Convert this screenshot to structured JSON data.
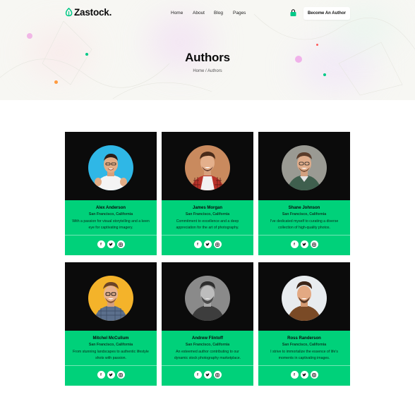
{
  "brand": {
    "name": "Zastock.",
    "color": "#00c987"
  },
  "nav": {
    "items": [
      {
        "label": "Home"
      },
      {
        "label": "About"
      },
      {
        "label": "Blog"
      },
      {
        "label": "Pages"
      }
    ],
    "cart_icon": "cart-icon",
    "cta_label": "Become An Author"
  },
  "hero": {
    "title": "Authors",
    "breadcrumb": "Home / Authors"
  },
  "authors": [
    {
      "name": "Alex Anderson",
      "location": "San Francisco, California",
      "bio": "With a passion for visual storytelling and a keen eye for captivating imagery.",
      "avatar_bg": "#2fb7e6"
    },
    {
      "name": "James Morgan",
      "location": "San Francisco, California",
      "bio": "Commitment to excellence and a deep appreciation for the art of photography.",
      "avatar_bg": "#c98a5e"
    },
    {
      "name": "Shane Johnson",
      "location": "San Francisco, California",
      "bio": "I've dedicated myself to curating a diverse collection of high-quality photos.",
      "avatar_bg": "#9a9a93"
    },
    {
      "name": "Mitchel McCullum",
      "location": "San Francisco, California",
      "bio": "From stunning landscapes to authentic lifestyle shots with passion.",
      "avatar_bg": "#f4b32a"
    },
    {
      "name": "Andrew Flintoff",
      "location": "San Francisco, California",
      "bio": "An esteemed author contributing to our dynamic stock photography marketplace.",
      "avatar_bg": "#8a8a8a"
    },
    {
      "name": "Ross Randerson",
      "location": "San Francisco, California",
      "bio": "I strive to immortalize the essence of life's moments in captivating images.",
      "avatar_bg": "#e8ecef"
    }
  ],
  "social_icons": [
    "facebook-icon",
    "twitter-icon",
    "instagram-icon"
  ],
  "colors": {
    "card_bg": "#0b0b0b",
    "card_info_bg": "#00d17a",
    "hero_bg": "#f7f7f3"
  }
}
